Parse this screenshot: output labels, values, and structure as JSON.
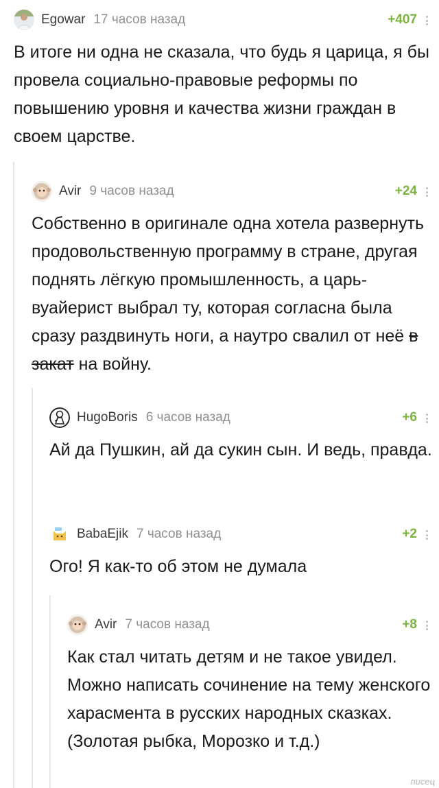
{
  "comments": [
    {
      "author": "Egowar",
      "time": "17 часов назад",
      "rating": "+407",
      "text": "В итоге ни одна не сказала, что будь я царица, я бы провела социально-правовые реформы по повышению уровня и качества жизни граждан в своем царстве.",
      "avatar_icon": "user-photo-avatar"
    },
    {
      "author": "Avir",
      "time": "9 часов назад",
      "rating": "+24",
      "text_before": "Собственно в оригинале одна хотела развернуть продовольственную программу в стране, другая поднять лёгкую промышленность, а царь-вуайерист выбрал ту, которая согласна была сразу раздвинуть ноги, а наутро свалил от неё ",
      "text_struck": "в закат",
      "text_after": " на войну.",
      "avatar_icon": "monkey-avatar"
    },
    {
      "author": "HugoBoris",
      "time": "6 часов назад",
      "rating": "+6",
      "text": "Ай да Пушкин, ай да сукин сын. И ведь, правда.",
      "avatar_icon": "astronaut-avatar"
    },
    {
      "author": "BabaEjik",
      "time": "7 часов назад",
      "rating": "+2",
      "text": "Ого! Я как-то об этом не думала",
      "avatar_icon": "cat-avatar"
    },
    {
      "author": "Avir",
      "time": "7 часов назад",
      "rating": "+8",
      "text": "Как стал читать детям и не такое увидел. Можно написать сочинение на тему женского харасмента в русских народных сказках. (Золотая рыбка, Морозко и т.д.)",
      "avatar_icon": "monkey-avatar"
    }
  ],
  "watermark": "писец",
  "colors": {
    "rating": "#7cb342",
    "time": "#8f8f8f",
    "branch_line": "#e6e6e6"
  }
}
